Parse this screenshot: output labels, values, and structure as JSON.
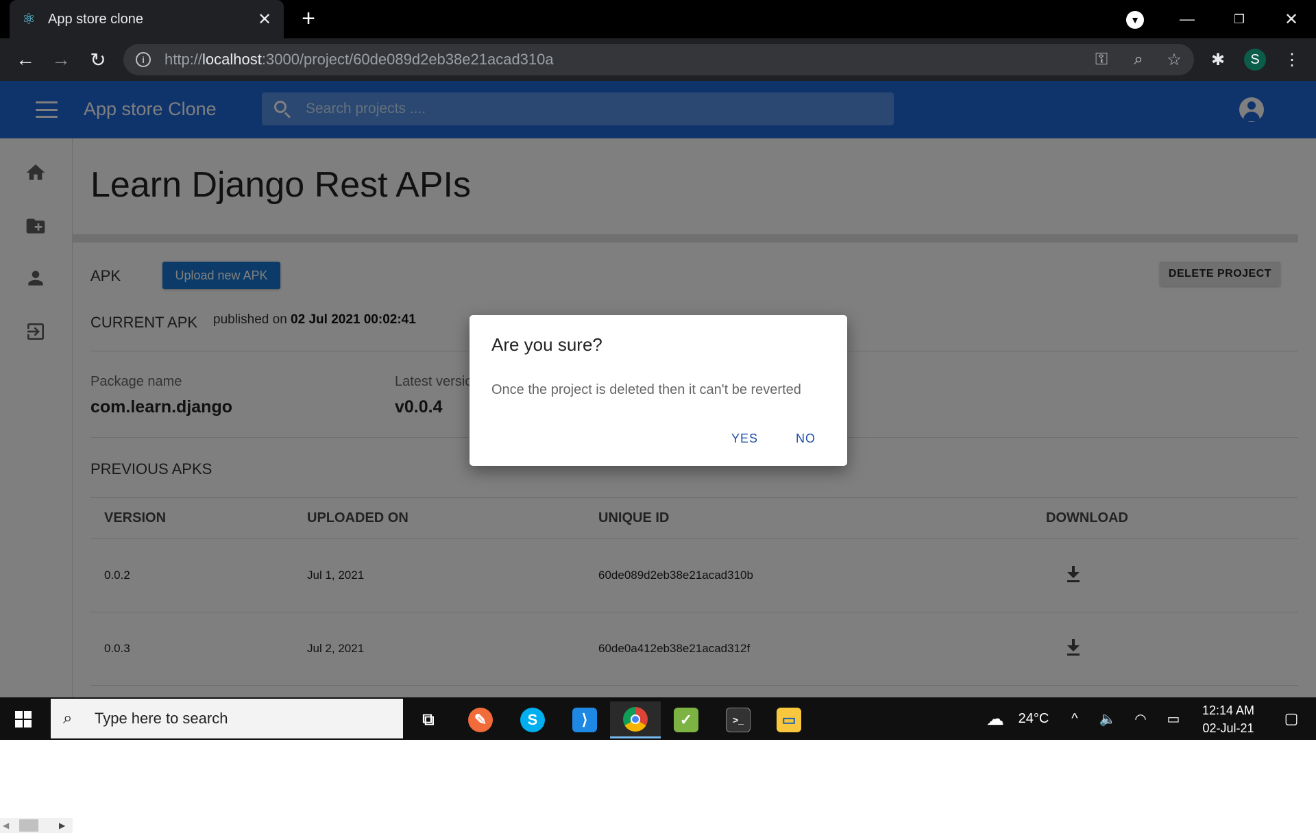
{
  "browser": {
    "tab_title": "App store clone",
    "url_prefix": "http://",
    "url_host": "localhost",
    "url_rest": ":3000/project/60de089d2eb38e21acad310a",
    "profile_initial": "S"
  },
  "appbar": {
    "title": "App store Clone",
    "search_placeholder": "Search projects ...."
  },
  "project": {
    "title": "Learn Django Rest APIs",
    "apk_label": "APK",
    "upload_button": "Upload new APK",
    "delete_button": "DELETE PROJECT",
    "current_apk_label": "CURRENT APK",
    "published_prefix": "published on",
    "published_date": "02 Jul 2021 00:02:41",
    "package_name_label": "Package name",
    "package_name": "com.learn.django",
    "latest_version_label": "Latest version",
    "latest_version": "v0.0.4",
    "previous_apks_label": "PREVIOUS APKS"
  },
  "table": {
    "headers": [
      "VERSION",
      "UPLOADED ON",
      "UNIQUE ID",
      "DOWNLOAD"
    ],
    "rows": [
      {
        "version": "0.0.2",
        "uploaded": "Jul 1, 2021",
        "id": "60de089d2eb38e21acad310b"
      },
      {
        "version": "0.0.3",
        "uploaded": "Jul 2, 2021",
        "id": "60de0a412eb38e21acad312f"
      }
    ]
  },
  "dialog": {
    "title": "Are you sure?",
    "message": "Once the project is deleted then it can't be reverted",
    "yes": "YES",
    "no": "NO"
  },
  "taskbar": {
    "search_placeholder": "Type here to search",
    "temperature": "24°C",
    "time": "12:14 AM",
    "date": "02-Jul-21"
  },
  "colors": {
    "appbar": "#1f66d6",
    "upload_button": "#1976d2",
    "dialog_action": "#1f4ea8"
  },
  "icons": [
    "react-icon",
    "home-icon",
    "create-folder-icon",
    "person-icon",
    "logout-icon",
    "download-icon",
    "account-circle-icon",
    "search-icon",
    "menu-icon"
  ]
}
